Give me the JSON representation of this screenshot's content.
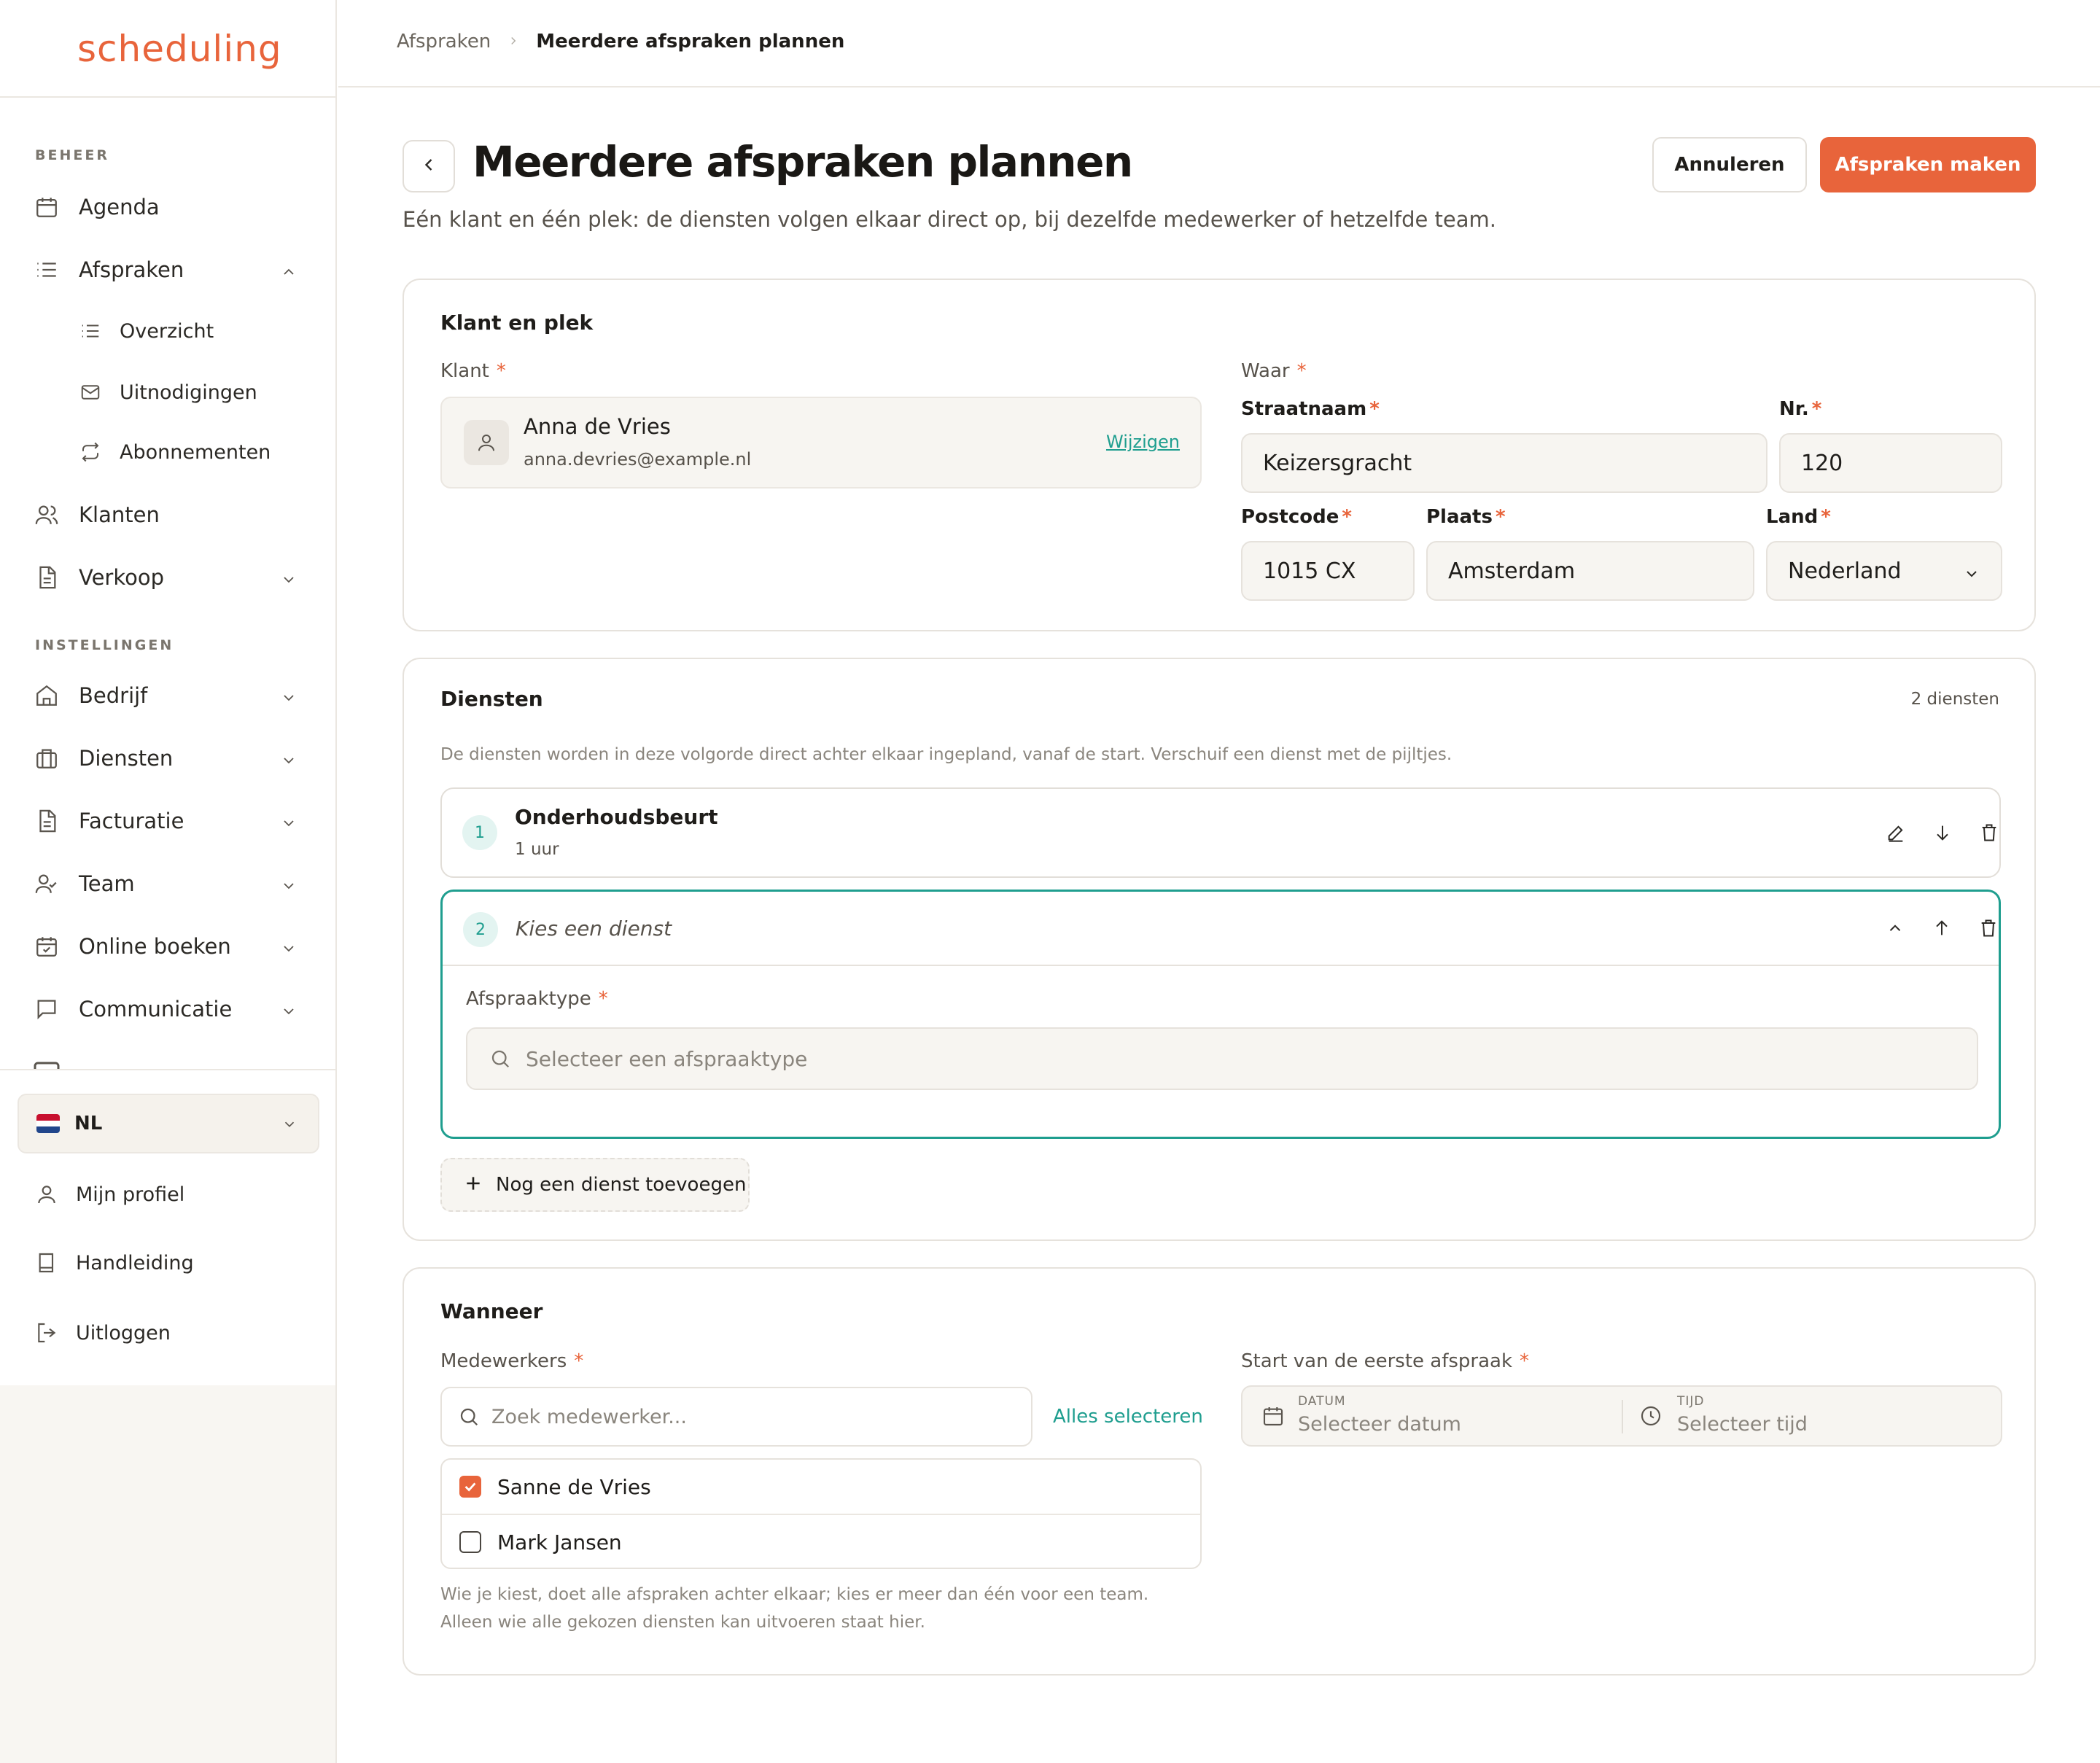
{
  "app": {
    "logo": "scheduling"
  },
  "sidebar": {
    "section_beheer": "BEHEER",
    "section_instellingen": "INSTELLINGEN",
    "items": [
      {
        "label": "Agenda",
        "icon": "calendar-icon"
      },
      {
        "label": "Afspraken",
        "icon": "list-icon",
        "expanded": true
      },
      {
        "label": "Klanten",
        "icon": "users-icon"
      },
      {
        "label": "Verkoop",
        "icon": "document-icon"
      },
      {
        "label": "Bedrijf",
        "icon": "building-icon"
      },
      {
        "label": "Diensten",
        "icon": "briefcase-icon"
      },
      {
        "label": "Facturatie",
        "icon": "invoice-icon"
      },
      {
        "label": "Team",
        "icon": "team-icon"
      },
      {
        "label": "Online boeken",
        "icon": "calendar-check-icon"
      },
      {
        "label": "Communicatie",
        "icon": "chat-icon"
      }
    ],
    "sub_items": [
      {
        "label": "Overzicht",
        "icon": "list-icon"
      },
      {
        "label": "Uitnodigingen",
        "icon": "mail-icon"
      },
      {
        "label": "Abonnementen",
        "icon": "repeat-icon"
      }
    ],
    "language": "NL",
    "footer": [
      {
        "label": "Mijn profiel",
        "icon": "user-icon"
      },
      {
        "label": "Handleiding",
        "icon": "book-icon"
      },
      {
        "label": "Uitloggen",
        "icon": "logout-icon"
      }
    ]
  },
  "breadcrumb": {
    "parent": "Afspraken",
    "current": "Meerdere afspraken plannen"
  },
  "page": {
    "title": "Meerdere afspraken plannen",
    "subtitle": "Eén klant en één plek: de diensten volgen elkaar direct op, bij dezelfde medewerker of hetzelfde team.",
    "cancel_label": "Annuleren",
    "submit_label": "Afspraken maken"
  },
  "client_section": {
    "title": "Klant en plek",
    "client_label": "Klant",
    "client_name": "Anna de Vries",
    "client_email": "anna.devries@example.nl",
    "change_label": "Wijzigen",
    "where_label": "Waar",
    "street_label": "Straatnaam",
    "street_value": "Keizersgracht",
    "number_label": "Nr.",
    "number_value": "120",
    "postcode_label": "Postcode",
    "postcode_value": "1015 CX",
    "city_label": "Plaats",
    "city_value": "Amsterdam",
    "country_label": "Land",
    "country_value": "Nederland"
  },
  "services_section": {
    "title": "Diensten",
    "count": "2 diensten",
    "description": "De diensten worden in deze volgorde direct achter elkaar ingepland, vanaf de start. Verschuif een dienst met de pijltjes.",
    "services": [
      {
        "number": "1",
        "name": "Onderhoudsbeurt",
        "duration": "1 uur"
      },
      {
        "number": "2",
        "name": "Kies een dienst"
      }
    ],
    "type_label": "Afspraaktype",
    "type_placeholder": "Selecteer een afspraaktype",
    "add_label": "Nog een dienst toevoegen"
  },
  "when_section": {
    "title": "Wanneer",
    "employees_label": "Medewerkers",
    "search_placeholder": "Zoek medewerker...",
    "select_all_label": "Alles selecteren",
    "employees": [
      {
        "name": "Sanne de Vries",
        "checked": true
      },
      {
        "name": "Mark Jansen",
        "checked": false
      }
    ],
    "hint": "Wie je kiest, doet alle afspraken achter elkaar; kies er meer dan één voor een team. Alleen wie alle gekozen diensten kan uitvoeren staat hier.",
    "start_label": "Start van de eerste afspraak",
    "date_small": "DATUM",
    "date_placeholder": "Selecteer datum",
    "time_small": "TIJD",
    "time_placeholder": "Selecteer tijd"
  },
  "colors": {
    "accent": "#e8643b",
    "teal": "#1f9e8f",
    "panel": "#f7f5f1"
  }
}
